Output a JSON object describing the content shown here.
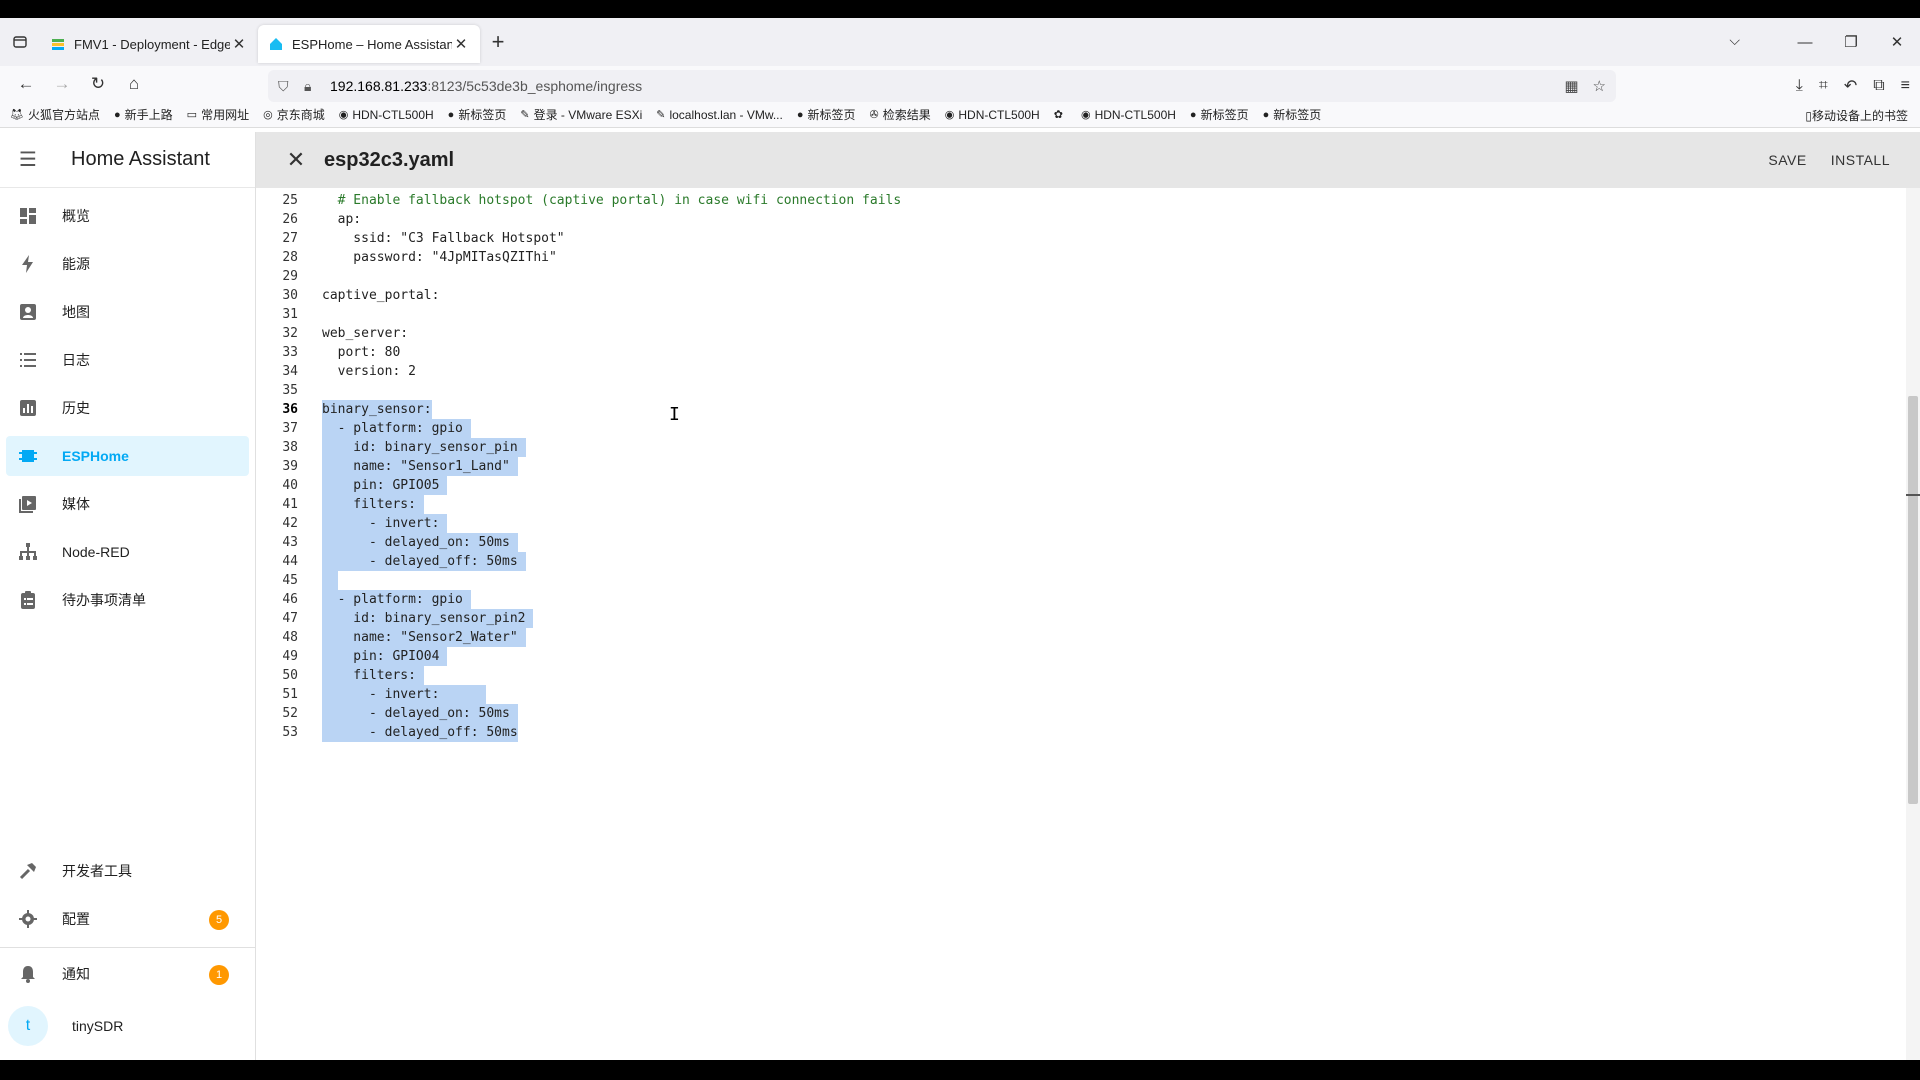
{
  "browser": {
    "tabs": [
      {
        "title": "FMV1 - Deployment - Edge I",
        "active": false
      },
      {
        "title": "ESPHome – Home Assistant",
        "active": true
      }
    ],
    "url_host": "192.168.81.233",
    "url_path": ":8123/5c53de3b_esphome/ingress",
    "bookmarks": [
      "火狐官方站点",
      "新手上路",
      "常用网址",
      "京东商城",
      "HDN-CTL500H",
      "新标签页",
      "登录 - VMware ESXi",
      "localhost.lan - VMw...",
      "新标签页",
      "检索结果",
      "HDN-CTL500H",
      "",
      "HDN-CTL500H",
      "新标签页",
      "新标签页"
    ],
    "mobile_bookmarks": "移动设备上的书签"
  },
  "sidebar": {
    "title": "Home Assistant",
    "items": [
      {
        "label": "概览",
        "icon": "dashboard-icon"
      },
      {
        "label": "能源",
        "icon": "lightning-icon"
      },
      {
        "label": "地图",
        "icon": "map-icon"
      },
      {
        "label": "日志",
        "icon": "list-icon"
      },
      {
        "label": "历史",
        "icon": "chart-icon"
      },
      {
        "label": "ESPHome",
        "icon": "chip-icon",
        "active": true
      },
      {
        "label": "媒体",
        "icon": "media-icon"
      },
      {
        "label": "Node-RED",
        "icon": "sitemap-icon"
      },
      {
        "label": "待办事项清单",
        "icon": "clipboard-icon"
      }
    ],
    "bottom_items": [
      {
        "label": "开发者工具",
        "icon": "hammer-icon"
      },
      {
        "label": "配置",
        "icon": "gear-icon",
        "badge": "5"
      }
    ],
    "notifications": {
      "label": "通知",
      "badge": "1"
    },
    "user": {
      "initial": "t",
      "name": "tinySDR"
    }
  },
  "editor": {
    "filename": "esp32c3.yaml",
    "save_label": "SAVE",
    "install_label": "INSTALL"
  },
  "code_lines": [
    {
      "n": "25",
      "t": "  # Enable fallback hotspot (captive portal) in case wifi connection fails"
    },
    {
      "n": "26",
      "t": "  ap:"
    },
    {
      "n": "27",
      "t": "    ssid: \"C3 Fallback Hotspot\""
    },
    {
      "n": "28",
      "t": "    password: \"4JpMITasQZIThi\""
    },
    {
      "n": "29",
      "t": ""
    },
    {
      "n": "30",
      "t": "captive_portal:"
    },
    {
      "n": "31",
      "t": ""
    },
    {
      "n": "32",
      "t": "web_server:"
    },
    {
      "n": "33",
      "t": "  port: 80"
    },
    {
      "n": "34",
      "t": "  version: 2"
    },
    {
      "n": "35",
      "t": ""
    },
    {
      "n": "36",
      "t": "binary_sensor:",
      "sel": true
    },
    {
      "n": "37",
      "t": "  - platform: gpio ",
      "sel": true
    },
    {
      "n": "38",
      "t": "    id: binary_sensor_pin ",
      "sel": true
    },
    {
      "n": "39",
      "t": "    name: \"Sensor1_Land\" ",
      "sel": true
    },
    {
      "n": "40",
      "t": "    pin: GPIO05 ",
      "sel": true
    },
    {
      "n": "41",
      "t": "    filters: ",
      "sel": true
    },
    {
      "n": "42",
      "t": "      - invert: ",
      "sel": true
    },
    {
      "n": "43",
      "t": "      - delayed_on: 50ms ",
      "sel": true
    },
    {
      "n": "44",
      "t": "      - delayed_off: 50ms ",
      "sel": true
    },
    {
      "n": "45",
      "t": "  ",
      "sel": true
    },
    {
      "n": "46",
      "t": "  - platform: gpio ",
      "sel": true
    },
    {
      "n": "47",
      "t": "    id: binary_sensor_pin2 ",
      "sel": true
    },
    {
      "n": "48",
      "t": "    name: \"Sensor2_Water\" ",
      "sel": true
    },
    {
      "n": "49",
      "t": "    pin: GPIO04 ",
      "sel": true
    },
    {
      "n": "50",
      "t": "    filters: ",
      "sel": true
    },
    {
      "n": "51",
      "t": "      - invert:      ",
      "sel": true
    },
    {
      "n": "52",
      "t": "      - delayed_on: 50ms ",
      "sel": true
    },
    {
      "n": "53",
      "t": "      - delayed_off: 50ms",
      "sel": true
    }
  ],
  "colors": {
    "accent": "#03a9f4",
    "badge": "#ff9800",
    "selection": "#bad4f4"
  }
}
